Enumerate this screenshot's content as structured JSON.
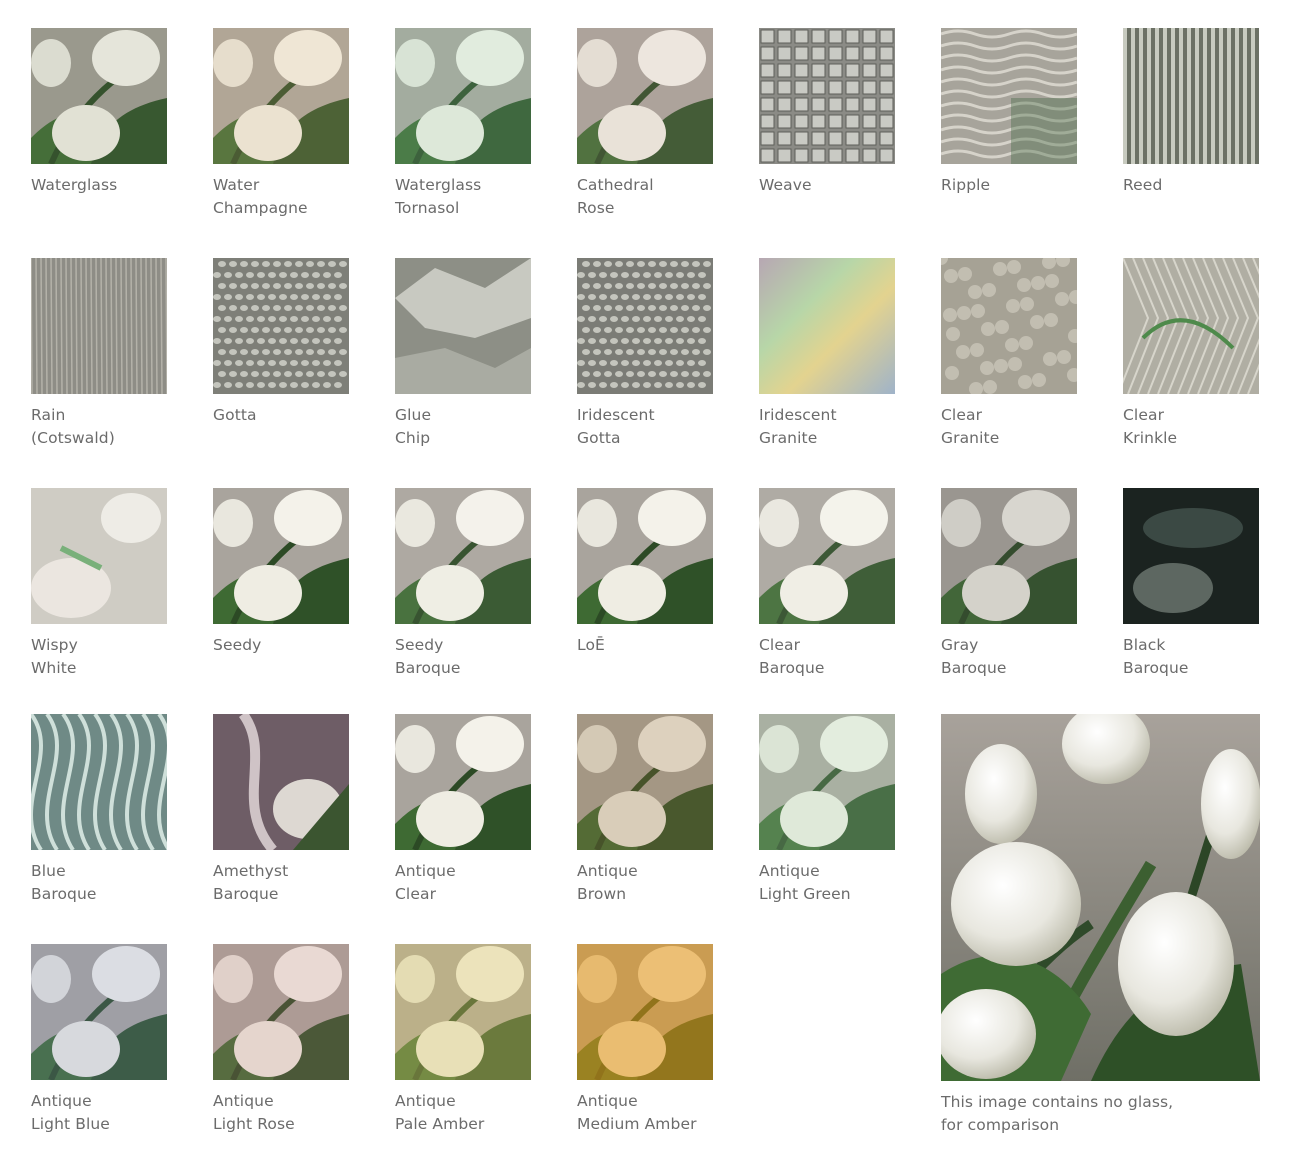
{
  "swatches": [
    {
      "id": "waterglass",
      "lines": [
        "Waterglass"
      ],
      "pattern": "waterglass-pattern"
    },
    {
      "id": "water-champagne",
      "lines": [
        "Water",
        "Champagne"
      ],
      "pattern": "tulip-pattern"
    },
    {
      "id": "waterglass-tornasol",
      "lines": [
        "Waterglass",
        "Tornasol"
      ],
      "pattern": "tulip-pattern"
    },
    {
      "id": "cathedral-rose",
      "lines": [
        "Cathedral",
        "Rose"
      ],
      "pattern": "tulip-pattern"
    },
    {
      "id": "weave",
      "lines": [
        "Weave"
      ],
      "pattern": "weave-pattern"
    },
    {
      "id": "ripple",
      "lines": [
        "Ripple"
      ],
      "pattern": "ripple-pattern"
    },
    {
      "id": "reed",
      "lines": [
        "Reed"
      ],
      "pattern": "reed-pattern"
    },
    {
      "id": "rain-cotswald",
      "lines": [
        "Rain",
        "(Cotswald)"
      ],
      "pattern": "rain-pattern"
    },
    {
      "id": "gotta",
      "lines": [
        "Gotta"
      ],
      "pattern": "gotta-pattern"
    },
    {
      "id": "glue-chip",
      "lines": [
        "Glue",
        "Chip"
      ],
      "pattern": "gluechip-pattern"
    },
    {
      "id": "iridescent-gotta",
      "lines": [
        "Iridescent",
        "Gotta"
      ],
      "pattern": "gotta-pattern"
    },
    {
      "id": "iridescent-granite",
      "lines": [
        "Iridescent",
        "Granite"
      ],
      "pattern": "iridescent-pattern"
    },
    {
      "id": "clear-granite",
      "lines": [
        "Clear",
        "Granite"
      ],
      "pattern": "granite-pattern"
    },
    {
      "id": "clear-krinkle",
      "lines": [
        "Clear",
        "Krinkle"
      ],
      "pattern": "krinkle-pattern"
    },
    {
      "id": "wispy-white",
      "lines": [
        "Wispy",
        "White"
      ],
      "pattern": "wispy-pattern"
    },
    {
      "id": "seedy",
      "lines": [
        "Seedy"
      ],
      "pattern": "tulip-pattern"
    },
    {
      "id": "seedy-baroque",
      "lines": [
        "Seedy",
        "Baroque"
      ],
      "pattern": "tulip-pattern"
    },
    {
      "id": "loe",
      "lines": [
        "LoĒ"
      ],
      "pattern": "tulip-pattern"
    },
    {
      "id": "clear-baroque",
      "lines": [
        "Clear",
        "Baroque"
      ],
      "pattern": "tulip-pattern"
    },
    {
      "id": "gray-baroque",
      "lines": [
        "Gray",
        "Baroque"
      ],
      "pattern": "tulip-pattern"
    },
    {
      "id": "black-baroque",
      "lines": [
        "Black",
        "Baroque"
      ],
      "pattern": "black-pattern"
    },
    {
      "id": "blue-baroque",
      "lines": [
        "Blue",
        "Baroque"
      ],
      "pattern": "bluebaroque-pattern"
    },
    {
      "id": "amethyst-baroque",
      "lines": [
        "Amethyst",
        "Baroque"
      ],
      "pattern": "amethyst-pattern"
    },
    {
      "id": "antique-clear",
      "lines": [
        "Antique",
        "Clear"
      ],
      "pattern": "tulip-pattern"
    },
    {
      "id": "antique-brown",
      "lines": [
        "Antique",
        "Brown"
      ],
      "pattern": "tulip-pattern"
    },
    {
      "id": "antique-light-green",
      "lines": [
        "Antique",
        "Light Green"
      ],
      "pattern": "tulip-pattern"
    },
    {
      "id": "antique-light-blue",
      "lines": [
        "Antique",
        "Light Blue"
      ],
      "pattern": "tulip-pattern"
    },
    {
      "id": "antique-light-rose",
      "lines": [
        "Antique",
        "Light Rose"
      ],
      "pattern": "tulip-pattern"
    },
    {
      "id": "antique-pale-amber",
      "lines": [
        "Antique",
        "Pale Amber"
      ],
      "pattern": "tulip-pattern"
    },
    {
      "id": "antique-medium-amber",
      "lines": [
        "Antique",
        "Medium Amber"
      ],
      "pattern": "tulip-pattern"
    }
  ],
  "comparison": {
    "lines": [
      "This image contains no glass,",
      "for comparison"
    ],
    "pattern": "tulip-photo"
  }
}
